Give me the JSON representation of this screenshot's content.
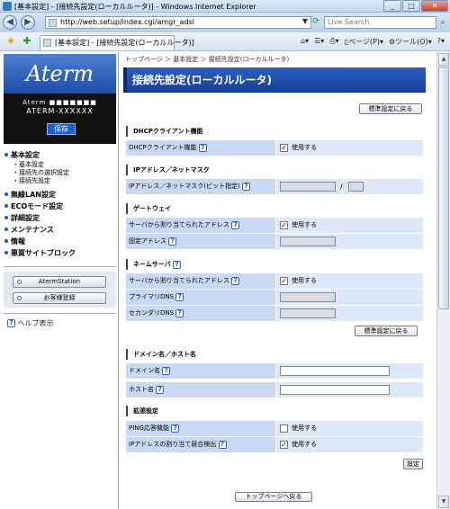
{
  "window": {
    "title": "[基本設定] - [接続先設定(ローカルルータ)] - Windows Internet Explorer"
  },
  "address": {
    "url": "http://web.setup/index.cgi/amgr_adsl",
    "search_placeholder": "Live Search"
  },
  "tab": {
    "label": "[基本設定] - [接続先設定(ローカルルータ)]"
  },
  "tools": {
    "page": "ページ(P)",
    "tools": "ツール(O)"
  },
  "sidebar": {
    "logo": "Aterm",
    "model": "Aterm ■■■■■■■",
    "device_id": "ATERM-XXXXXX",
    "save": "保存",
    "menu": [
      {
        "label": "基本設定",
        "subs": [
          "基本設定",
          "接続先の選択設定",
          "接続先設定"
        ]
      },
      {
        "label": "無線LAN設定",
        "subs": []
      },
      {
        "label": "ECOモード設定",
        "subs": []
      },
      {
        "label": "詳細設定",
        "subs": []
      },
      {
        "label": "メンテナンス",
        "subs": []
      },
      {
        "label": "情報",
        "subs": []
      },
      {
        "label": "悪質サイトブロック",
        "subs": []
      }
    ],
    "aterm_station": "AtermStation",
    "register": "お客様登録",
    "help": "ヘルプ表示"
  },
  "main": {
    "breadcrumb": "トップページ ＞ 基本設定 ＞ 接続先設定(ローカルルータ)",
    "title": "接続先設定(ローカルルータ)",
    "reset_defaults": "標準設定に戻る",
    "sections": {
      "dhcp": {
        "title": "DHCPクライアント機能",
        "row": "DHCPクライアント機能",
        "check": "使用する",
        "checked": true
      },
      "ip": {
        "title": "IPアドレス／ネットマスク",
        "row": "IPアドレス／ネットマスク(ビット指定)",
        "sep": "/"
      },
      "gw": {
        "title": "ゲートウェイ",
        "row1": "サーバから割り当てられたアドレス",
        "check": "使用する",
        "checked": true,
        "row2": "固定アドレス"
      },
      "dns": {
        "title": "ネームサーバ",
        "row1": "サーバから割り当てられたアドレス",
        "check": "使用する",
        "checked": true,
        "row2": "プライマリDNS",
        "row3": "セカンダリDNS"
      },
      "domain": {
        "title": "ドメイン名／ホスト名",
        "row1": "ドメイン名",
        "row2": "ホスト名"
      },
      "ext": {
        "title": "拡張設定",
        "row1": "PING応答機能",
        "check1": "使用する",
        "checked1": false,
        "row2": "IPアドレスの割り当て競合検出",
        "check2": "使用する",
        "checked2": true
      }
    },
    "apply": "設定",
    "back_top": "トップページへ戻る"
  }
}
